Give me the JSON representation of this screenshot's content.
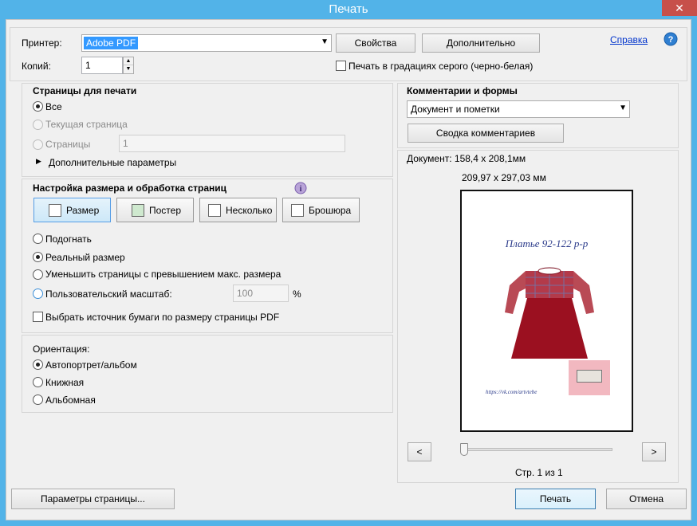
{
  "window": {
    "title": "Печать"
  },
  "printer": {
    "label": "Принтер:",
    "selected": "Adobe PDF",
    "properties_btn": "Свойства",
    "advanced_btn": "Дополнительно",
    "help_link": "Справка",
    "copies_label": "Копий:",
    "copies_value": "1",
    "grayscale_label": "Печать в градациях серого (черно-белая)"
  },
  "pages": {
    "heading": "Страницы для печати",
    "all": "Все",
    "current": "Текущая страница",
    "pages_label": "Страницы",
    "pages_value": "1",
    "more_options": "Дополнительные параметры"
  },
  "sizing": {
    "heading": "Настройка размера и обработка страниц",
    "tabs": [
      "Размер",
      "Постер",
      "Несколько",
      "Брошюра"
    ],
    "fit": "Подогнать",
    "actual": "Реальный размер",
    "shrink": "Уменьшить страницы с превышением макс. размера",
    "custom": "Пользовательский масштаб:",
    "custom_value": "100",
    "percent": "%",
    "paper_source": "Выбрать источник бумаги по размеру страницы PDF"
  },
  "orientation": {
    "heading": "Ориентация:",
    "auto": "Автопортрет/альбом",
    "portrait": "Книжная",
    "landscape": "Альбомная"
  },
  "comments": {
    "heading": "Комментарии и формы",
    "selected": "Документ и пометки",
    "summary_btn": "Сводка комментариев"
  },
  "preview": {
    "doc_size": "Документ: 158,4 x 208,1мм",
    "paper_size": "209,97 x 297,03 мм",
    "page_title": "Платье 92-122 р-р",
    "page_url": "https://vk.com/artvtebe",
    "prev": "<",
    "next": ">",
    "page_counter": "Стр. 1 из 1",
    "slider_position": 0
  },
  "footer": {
    "page_setup": "Параметры страницы...",
    "print": "Печать",
    "cancel": "Отмена"
  },
  "colors": {
    "titlebar": "#52b3e8",
    "close": "#c7504a",
    "selection": "#3399ff",
    "dress": "#9b1020"
  }
}
